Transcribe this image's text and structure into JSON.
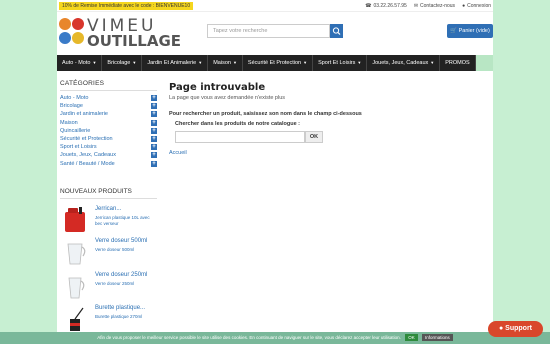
{
  "topbar": {
    "promo": "10% de Remise Immédiate avec le code : BIENVENUE10",
    "phone": "03.22.26.57.95",
    "contact": "Contactez-nous",
    "login": "Connexion"
  },
  "header": {
    "logo_line1": "VIMEU",
    "logo_line2": "OUTILLAGE",
    "search_placeholder": "Tapez votre recherche",
    "cart": "Panier (vide)"
  },
  "nav": [
    "Auto - Moto",
    "Bricolage",
    "Jardin Et Animalerie",
    "Maison",
    "Sécurité Et Protection",
    "Sport Et Loisirs",
    "Jouets, Jeux, Cadeaux",
    "PROMOS"
  ],
  "sidebar": {
    "title": "CATÉGORIES",
    "categories": [
      "Auto - Moto",
      "Bricolage",
      "Jardin et animalerie",
      "Maison",
      "Quincaillerie",
      "Sécurité et Protection",
      "Sport et Loisirs",
      "Jouets, Jeux, Cadeaux",
      "Santé / Beauté / Mode"
    ],
    "new_title": "NOUVEAUX PRODUITS",
    "products": [
      {
        "name": "Jerrican...",
        "desc": "Jerrican plastique 10L avec bec verseur"
      },
      {
        "name": "Verre doseur 500ml",
        "desc": "Verre doseur 500ml"
      },
      {
        "name": "Verre doseur 250ml",
        "desc": "Verre doseur 250ml"
      },
      {
        "name": "Burette plastique...",
        "desc": "Burette plastique 270ml"
      }
    ]
  },
  "main": {
    "title": "Page introuvable",
    "subtitle": "La page que vous avez demandée n'existe plus",
    "hint": "Pour rechercher un produit, saisissez son nom dans le champ ci-dessous",
    "search_label": "Chercher dans les produits de notre catalogue :",
    "ok": "OK",
    "home_link": "Accueil"
  },
  "cookie": {
    "text": "Afin de vous proposer le meilleur service possible le site utilise des cookies. En continuant de naviguer sur le site, vous déclarez accepter leur utilisation.",
    "ok": "OK",
    "info": "Informations"
  },
  "support": "Support",
  "colors": {
    "accent": "#2f6fb5",
    "promo": "#f5d61e",
    "nav": "#222222",
    "support": "#d9472b"
  }
}
